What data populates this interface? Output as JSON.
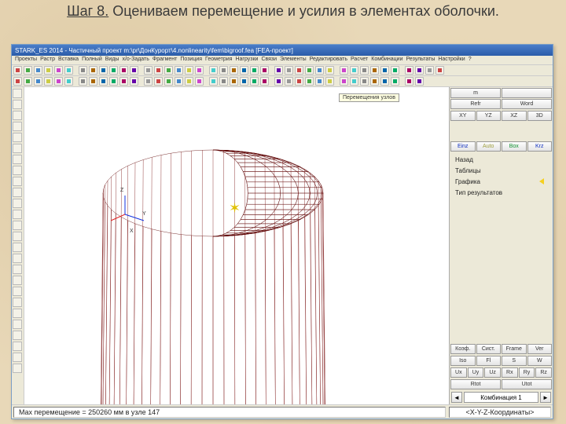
{
  "page": {
    "step_label": "Шаг 8.",
    "title_rest": " Оцениваем перемещение и усилия в элементах оболочки."
  },
  "window": {
    "title": "STARK_ES 2014 - Частичный проект m:\\pr\\ДонКурорт\\4.nonlinearity\\fem\\bigroof.fea  [FEA-проект]"
  },
  "menu": [
    "Проекты",
    "Растр",
    "Вставка",
    "Полный",
    "Виды",
    "x/o-Задать",
    "Фрагмент",
    "Позиция",
    "Геометрия",
    "Нагрузки",
    "Связи",
    "Элементы",
    "Редактировать",
    "Расчет",
    "Комбинации",
    "Результаты",
    "Настройки",
    "?"
  ],
  "tooltip": "Перемещения узлов",
  "axes": {
    "x": "X",
    "y": "Y",
    "z": "Z"
  },
  "right_panel": {
    "row1": [
      "m",
      "",
      "Refr",
      "Word"
    ],
    "view_row": [
      "XY",
      "YZ",
      "XZ",
      "3D"
    ],
    "einz_row": [
      "Einz",
      "Auto",
      "Box",
      "Krz"
    ],
    "list": [
      "Назад",
      "Таблицы",
      "Графика",
      "Тип результатов"
    ],
    "coef_row": [
      "Коэф.",
      "Сист.",
      "Frame",
      "Ver"
    ],
    "iso_row": [
      "Iso",
      "Fl",
      "S",
      "W"
    ],
    "u_row": [
      "Ux",
      "Uy",
      "Uz",
      "Rx",
      "Ry",
      "Rz"
    ],
    "rt_row": [
      "Rtot",
      "Utot"
    ],
    "combo": "Комбинация 1"
  },
  "statusbar": {
    "left": "Max перемещение  = 250260 мм в узле 147",
    "right": "<X-Y-Z-Координаты>"
  }
}
